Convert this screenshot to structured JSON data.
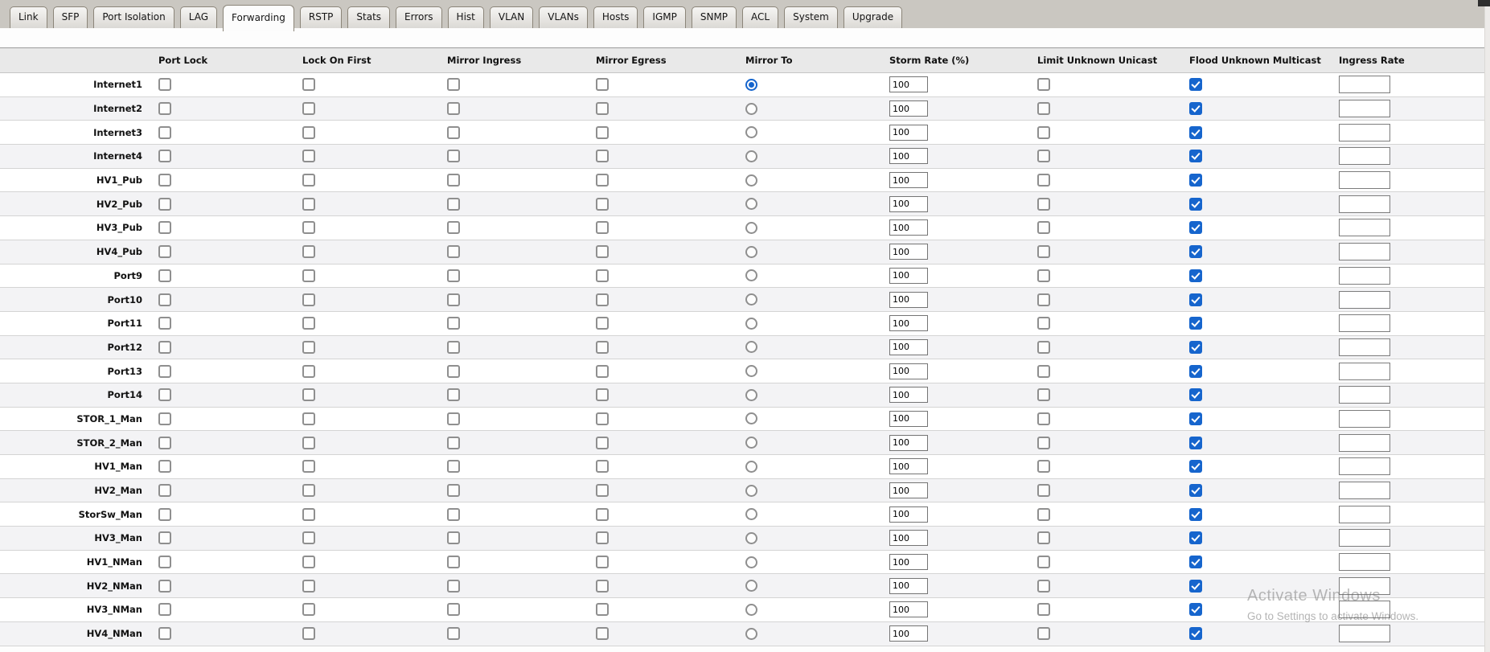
{
  "colors": {
    "accent": "#1665cd",
    "tabbar_bg": "#cac7c1",
    "header_bg": "#e9e9e9",
    "alt_row_bg": "#f3f3f5"
  },
  "tabs": {
    "items": [
      {
        "label": "Link",
        "active": false
      },
      {
        "label": "SFP",
        "active": false
      },
      {
        "label": "Port Isolation",
        "active": false
      },
      {
        "label": "LAG",
        "active": false
      },
      {
        "label": "Forwarding",
        "active": true
      },
      {
        "label": "RSTP",
        "active": false
      },
      {
        "label": "Stats",
        "active": false
      },
      {
        "label": "Errors",
        "active": false
      },
      {
        "label": "Hist",
        "active": false
      },
      {
        "label": "VLAN",
        "active": false
      },
      {
        "label": "VLANs",
        "active": false
      },
      {
        "label": "Hosts",
        "active": false
      },
      {
        "label": "IGMP",
        "active": false
      },
      {
        "label": "SNMP",
        "active": false
      },
      {
        "label": "ACL",
        "active": false
      },
      {
        "label": "System",
        "active": false
      },
      {
        "label": "Upgrade",
        "active": false
      }
    ]
  },
  "table": {
    "columns": [
      "Port Lock",
      "Lock On First",
      "Mirror Ingress",
      "Mirror Egress",
      "Mirror To",
      "Storm Rate (%)",
      "Limit Unknown Unicast",
      "Flood Unknown Multicast",
      "Ingress Rate"
    ],
    "rows": [
      {
        "name": "Internet1",
        "port_lock": false,
        "lock_on_first": false,
        "mirror_ingress": false,
        "mirror_egress": false,
        "mirror_to": true,
        "storm_rate": "100",
        "limit_unknown_unicast": false,
        "flood_unknown_multicast": true,
        "ingress_rate": ""
      },
      {
        "name": "Internet2",
        "port_lock": false,
        "lock_on_first": false,
        "mirror_ingress": false,
        "mirror_egress": false,
        "mirror_to": false,
        "storm_rate": "100",
        "limit_unknown_unicast": false,
        "flood_unknown_multicast": true,
        "ingress_rate": ""
      },
      {
        "name": "Internet3",
        "port_lock": false,
        "lock_on_first": false,
        "mirror_ingress": false,
        "mirror_egress": false,
        "mirror_to": false,
        "storm_rate": "100",
        "limit_unknown_unicast": false,
        "flood_unknown_multicast": true,
        "ingress_rate": ""
      },
      {
        "name": "Internet4",
        "port_lock": false,
        "lock_on_first": false,
        "mirror_ingress": false,
        "mirror_egress": false,
        "mirror_to": false,
        "storm_rate": "100",
        "limit_unknown_unicast": false,
        "flood_unknown_multicast": true,
        "ingress_rate": ""
      },
      {
        "name": "HV1_Pub",
        "port_lock": false,
        "lock_on_first": false,
        "mirror_ingress": false,
        "mirror_egress": false,
        "mirror_to": false,
        "storm_rate": "100",
        "limit_unknown_unicast": false,
        "flood_unknown_multicast": true,
        "ingress_rate": ""
      },
      {
        "name": "HV2_Pub",
        "port_lock": false,
        "lock_on_first": false,
        "mirror_ingress": false,
        "mirror_egress": false,
        "mirror_to": false,
        "storm_rate": "100",
        "limit_unknown_unicast": false,
        "flood_unknown_multicast": true,
        "ingress_rate": ""
      },
      {
        "name": "HV3_Pub",
        "port_lock": false,
        "lock_on_first": false,
        "mirror_ingress": false,
        "mirror_egress": false,
        "mirror_to": false,
        "storm_rate": "100",
        "limit_unknown_unicast": false,
        "flood_unknown_multicast": true,
        "ingress_rate": ""
      },
      {
        "name": "HV4_Pub",
        "port_lock": false,
        "lock_on_first": false,
        "mirror_ingress": false,
        "mirror_egress": false,
        "mirror_to": false,
        "storm_rate": "100",
        "limit_unknown_unicast": false,
        "flood_unknown_multicast": true,
        "ingress_rate": ""
      },
      {
        "name": "Port9",
        "port_lock": false,
        "lock_on_first": false,
        "mirror_ingress": false,
        "mirror_egress": false,
        "mirror_to": false,
        "storm_rate": "100",
        "limit_unknown_unicast": false,
        "flood_unknown_multicast": true,
        "ingress_rate": ""
      },
      {
        "name": "Port10",
        "port_lock": false,
        "lock_on_first": false,
        "mirror_ingress": false,
        "mirror_egress": false,
        "mirror_to": false,
        "storm_rate": "100",
        "limit_unknown_unicast": false,
        "flood_unknown_multicast": true,
        "ingress_rate": ""
      },
      {
        "name": "Port11",
        "port_lock": false,
        "lock_on_first": false,
        "mirror_ingress": false,
        "mirror_egress": false,
        "mirror_to": false,
        "storm_rate": "100",
        "limit_unknown_unicast": false,
        "flood_unknown_multicast": true,
        "ingress_rate": ""
      },
      {
        "name": "Port12",
        "port_lock": false,
        "lock_on_first": false,
        "mirror_ingress": false,
        "mirror_egress": false,
        "mirror_to": false,
        "storm_rate": "100",
        "limit_unknown_unicast": false,
        "flood_unknown_multicast": true,
        "ingress_rate": ""
      },
      {
        "name": "Port13",
        "port_lock": false,
        "lock_on_first": false,
        "mirror_ingress": false,
        "mirror_egress": false,
        "mirror_to": false,
        "storm_rate": "100",
        "limit_unknown_unicast": false,
        "flood_unknown_multicast": true,
        "ingress_rate": ""
      },
      {
        "name": "Port14",
        "port_lock": false,
        "lock_on_first": false,
        "mirror_ingress": false,
        "mirror_egress": false,
        "mirror_to": false,
        "storm_rate": "100",
        "limit_unknown_unicast": false,
        "flood_unknown_multicast": true,
        "ingress_rate": ""
      },
      {
        "name": "STOR_1_Man",
        "port_lock": false,
        "lock_on_first": false,
        "mirror_ingress": false,
        "mirror_egress": false,
        "mirror_to": false,
        "storm_rate": "100",
        "limit_unknown_unicast": false,
        "flood_unknown_multicast": true,
        "ingress_rate": ""
      },
      {
        "name": "STOR_2_Man",
        "port_lock": false,
        "lock_on_first": false,
        "mirror_ingress": false,
        "mirror_egress": false,
        "mirror_to": false,
        "storm_rate": "100",
        "limit_unknown_unicast": false,
        "flood_unknown_multicast": true,
        "ingress_rate": ""
      },
      {
        "name": "HV1_Man",
        "port_lock": false,
        "lock_on_first": false,
        "mirror_ingress": false,
        "mirror_egress": false,
        "mirror_to": false,
        "storm_rate": "100",
        "limit_unknown_unicast": false,
        "flood_unknown_multicast": true,
        "ingress_rate": ""
      },
      {
        "name": "HV2_Man",
        "port_lock": false,
        "lock_on_first": false,
        "mirror_ingress": false,
        "mirror_egress": false,
        "mirror_to": false,
        "storm_rate": "100",
        "limit_unknown_unicast": false,
        "flood_unknown_multicast": true,
        "ingress_rate": ""
      },
      {
        "name": "StorSw_Man",
        "port_lock": false,
        "lock_on_first": false,
        "mirror_ingress": false,
        "mirror_egress": false,
        "mirror_to": false,
        "storm_rate": "100",
        "limit_unknown_unicast": false,
        "flood_unknown_multicast": true,
        "ingress_rate": ""
      },
      {
        "name": "HV3_Man",
        "port_lock": false,
        "lock_on_first": false,
        "mirror_ingress": false,
        "mirror_egress": false,
        "mirror_to": false,
        "storm_rate": "100",
        "limit_unknown_unicast": false,
        "flood_unknown_multicast": true,
        "ingress_rate": ""
      },
      {
        "name": "HV1_NMan",
        "port_lock": false,
        "lock_on_first": false,
        "mirror_ingress": false,
        "mirror_egress": false,
        "mirror_to": false,
        "storm_rate": "100",
        "limit_unknown_unicast": false,
        "flood_unknown_multicast": true,
        "ingress_rate": ""
      },
      {
        "name": "HV2_NMan",
        "port_lock": false,
        "lock_on_first": false,
        "mirror_ingress": false,
        "mirror_egress": false,
        "mirror_to": false,
        "storm_rate": "100",
        "limit_unknown_unicast": false,
        "flood_unknown_multicast": true,
        "ingress_rate": ""
      },
      {
        "name": "HV3_NMan",
        "port_lock": false,
        "lock_on_first": false,
        "mirror_ingress": false,
        "mirror_egress": false,
        "mirror_to": false,
        "storm_rate": "100",
        "limit_unknown_unicast": false,
        "flood_unknown_multicast": true,
        "ingress_rate": ""
      },
      {
        "name": "HV4_NMan",
        "port_lock": false,
        "lock_on_first": false,
        "mirror_ingress": false,
        "mirror_egress": false,
        "mirror_to": false,
        "storm_rate": "100",
        "limit_unknown_unicast": false,
        "flood_unknown_multicast": true,
        "ingress_rate": ""
      }
    ]
  },
  "watermark": {
    "line1": "Activate Windows",
    "line2": "Go to Settings to activate Windows."
  }
}
